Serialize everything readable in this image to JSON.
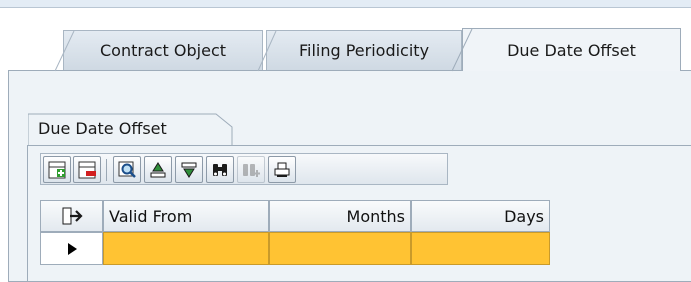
{
  "tabs": [
    {
      "label": "Contract Object",
      "active": false
    },
    {
      "label": "Filing Periodicity",
      "active": false
    },
    {
      "label": "Due Date Offset",
      "active": true
    }
  ],
  "group": {
    "title": "Due Date Offset"
  },
  "toolbar": {
    "buttons": [
      {
        "name": "insert-row-button",
        "icon": "insert-row-icon",
        "enabled": true
      },
      {
        "name": "delete-row-button",
        "icon": "delete-row-icon",
        "enabled": true
      },
      {
        "name": "details-button",
        "icon": "magnifier-icon",
        "enabled": true
      },
      {
        "name": "sort-ascending-button",
        "icon": "sort-ascending-icon",
        "enabled": true
      },
      {
        "name": "sort-descending-button",
        "icon": "sort-descending-icon",
        "enabled": true
      },
      {
        "name": "find-button",
        "icon": "binoculars-icon",
        "enabled": true
      },
      {
        "name": "find-next-button",
        "icon": "binoculars-plus-icon",
        "enabled": false
      },
      {
        "name": "print-button",
        "icon": "printer-icon",
        "enabled": true
      }
    ]
  },
  "table": {
    "columns": [
      "Valid From",
      "Months",
      "Days"
    ],
    "rows": [
      [
        "",
        "",
        ""
      ]
    ],
    "selection_icon": "column-select-icon",
    "row_marker_icon": "row-pointer-icon"
  },
  "colors": {
    "selected_row": "#ffc333",
    "accent": "#9eacba"
  }
}
